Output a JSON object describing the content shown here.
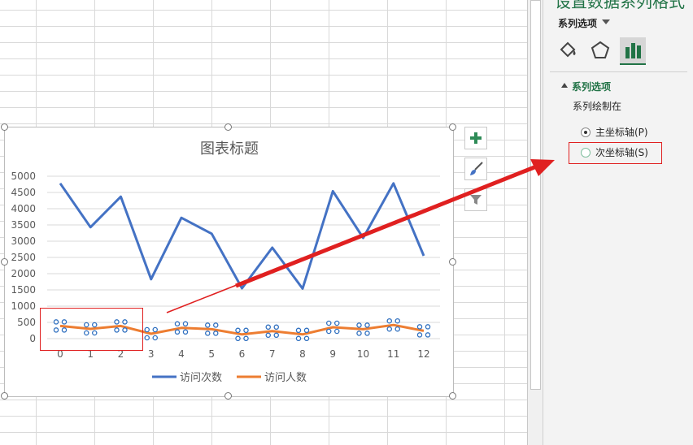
{
  "pane": {
    "title": "设置数据系列格式",
    "series_options_label": "系列选项",
    "tabs": [
      "fill-line-icon",
      "effects-pentagon-icon",
      "series-options-chart-icon"
    ],
    "section_title": "系列选项",
    "plot_on_label": "系列绘制在",
    "primary_axis_label": "主坐标轴(P)",
    "secondary_axis_label": "次坐标轴(S)",
    "selected_axis": "primary"
  },
  "chart_buttons": [
    "plus-icon",
    "brush-icon",
    "filter-icon"
  ],
  "chart_data": {
    "type": "line",
    "title": "图表标题",
    "categories": [
      "0",
      "1",
      "2",
      "3",
      "4",
      "5",
      "6",
      "7",
      "8",
      "9",
      "10",
      "11",
      "12"
    ],
    "ylim": [
      0,
      5000
    ],
    "yticks": [
      "5000",
      "4500",
      "4000",
      "3500",
      "3000",
      "2500",
      "2000",
      "1500",
      "1000",
      "500",
      "0"
    ],
    "grid": true,
    "legend_position": "bottom",
    "series": [
      {
        "name": "访问次数",
        "color": "#4472c4",
        "values": [
          4780,
          3430,
          4370,
          1830,
          3720,
          3230,
          1550,
          2800,
          1540,
          4540,
          3100,
          4780,
          2550
        ]
      },
      {
        "name": "访问人数",
        "color": "#ed7d31",
        "values": [
          390,
          300,
          390,
          150,
          330,
          290,
          130,
          230,
          130,
          350,
          290,
          420,
          240
        ]
      }
    ]
  },
  "colors": {
    "accent": "#217346",
    "annotation": "#e02020"
  }
}
